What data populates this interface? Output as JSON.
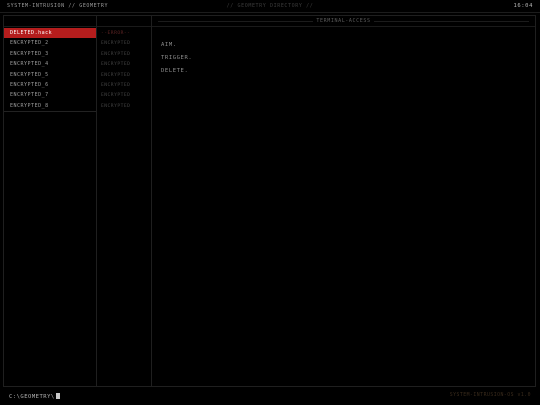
{
  "topbar": {
    "app_title": "SYSTEM-INTRUSION // GEOMETRY",
    "directory": "// GEOMETRY DIRECTORY //",
    "clock": "16:04"
  },
  "sidebar": {
    "files": [
      {
        "label": "DELETED.hack",
        "selected": true
      },
      {
        "label": "ENCRYPTED_2",
        "selected": false
      },
      {
        "label": "ENCRYPTED_3",
        "selected": false
      },
      {
        "label": "ENCRYPTED_4",
        "selected": false
      },
      {
        "label": "ENCRYPTED_5",
        "selected": false
      },
      {
        "label": "ENCRYPTED_6",
        "selected": false
      },
      {
        "label": "ENCRYPTED_7",
        "selected": false
      },
      {
        "label": "ENCRYPTED_8",
        "selected": false
      }
    ]
  },
  "secondary": {
    "items": [
      "--ERROR--",
      "ENCRYPTED",
      "ENCRYPTED",
      "ENCRYPTED",
      "ENCRYPTED",
      "ENCRYPTED",
      "ENCRYPTED",
      "ENCRYPTED"
    ]
  },
  "main": {
    "header": "TERMINAL-ACCESS",
    "lines": [
      "AIM.",
      "TRIGGER.",
      "DELETE."
    ]
  },
  "footer": {
    "prompt": "C:\\GEOMETRY\\",
    "version": "SYSTEM-INTRUSION-OS v1.0"
  },
  "colors": {
    "accent": "#b51d1d",
    "background": "#000000"
  }
}
